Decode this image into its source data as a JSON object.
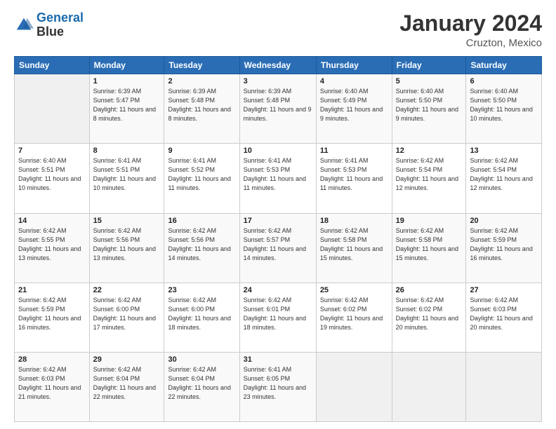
{
  "logo": {
    "line1": "General",
    "line2": "Blue"
  },
  "title": "January 2024",
  "location": "Cruzton, Mexico",
  "days_header": [
    "Sunday",
    "Monday",
    "Tuesday",
    "Wednesday",
    "Thursday",
    "Friday",
    "Saturday"
  ],
  "weeks": [
    [
      {
        "num": "",
        "sunrise": "",
        "sunset": "",
        "daylight": ""
      },
      {
        "num": "1",
        "sunrise": "Sunrise: 6:39 AM",
        "sunset": "Sunset: 5:47 PM",
        "daylight": "Daylight: 11 hours and 8 minutes."
      },
      {
        "num": "2",
        "sunrise": "Sunrise: 6:39 AM",
        "sunset": "Sunset: 5:48 PM",
        "daylight": "Daylight: 11 hours and 8 minutes."
      },
      {
        "num": "3",
        "sunrise": "Sunrise: 6:39 AM",
        "sunset": "Sunset: 5:48 PM",
        "daylight": "Daylight: 11 hours and 9 minutes."
      },
      {
        "num": "4",
        "sunrise": "Sunrise: 6:40 AM",
        "sunset": "Sunset: 5:49 PM",
        "daylight": "Daylight: 11 hours and 9 minutes."
      },
      {
        "num": "5",
        "sunrise": "Sunrise: 6:40 AM",
        "sunset": "Sunset: 5:50 PM",
        "daylight": "Daylight: 11 hours and 9 minutes."
      },
      {
        "num": "6",
        "sunrise": "Sunrise: 6:40 AM",
        "sunset": "Sunset: 5:50 PM",
        "daylight": "Daylight: 11 hours and 10 minutes."
      }
    ],
    [
      {
        "num": "7",
        "sunrise": "Sunrise: 6:40 AM",
        "sunset": "Sunset: 5:51 PM",
        "daylight": "Daylight: 11 hours and 10 minutes."
      },
      {
        "num": "8",
        "sunrise": "Sunrise: 6:41 AM",
        "sunset": "Sunset: 5:51 PM",
        "daylight": "Daylight: 11 hours and 10 minutes."
      },
      {
        "num": "9",
        "sunrise": "Sunrise: 6:41 AM",
        "sunset": "Sunset: 5:52 PM",
        "daylight": "Daylight: 11 hours and 11 minutes."
      },
      {
        "num": "10",
        "sunrise": "Sunrise: 6:41 AM",
        "sunset": "Sunset: 5:53 PM",
        "daylight": "Daylight: 11 hours and 11 minutes."
      },
      {
        "num": "11",
        "sunrise": "Sunrise: 6:41 AM",
        "sunset": "Sunset: 5:53 PM",
        "daylight": "Daylight: 11 hours and 11 minutes."
      },
      {
        "num": "12",
        "sunrise": "Sunrise: 6:42 AM",
        "sunset": "Sunset: 5:54 PM",
        "daylight": "Daylight: 11 hours and 12 minutes."
      },
      {
        "num": "13",
        "sunrise": "Sunrise: 6:42 AM",
        "sunset": "Sunset: 5:54 PM",
        "daylight": "Daylight: 11 hours and 12 minutes."
      }
    ],
    [
      {
        "num": "14",
        "sunrise": "Sunrise: 6:42 AM",
        "sunset": "Sunset: 5:55 PM",
        "daylight": "Daylight: 11 hours and 13 minutes."
      },
      {
        "num": "15",
        "sunrise": "Sunrise: 6:42 AM",
        "sunset": "Sunset: 5:56 PM",
        "daylight": "Daylight: 11 hours and 13 minutes."
      },
      {
        "num": "16",
        "sunrise": "Sunrise: 6:42 AM",
        "sunset": "Sunset: 5:56 PM",
        "daylight": "Daylight: 11 hours and 14 minutes."
      },
      {
        "num": "17",
        "sunrise": "Sunrise: 6:42 AM",
        "sunset": "Sunset: 5:57 PM",
        "daylight": "Daylight: 11 hours and 14 minutes."
      },
      {
        "num": "18",
        "sunrise": "Sunrise: 6:42 AM",
        "sunset": "Sunset: 5:58 PM",
        "daylight": "Daylight: 11 hours and 15 minutes."
      },
      {
        "num": "19",
        "sunrise": "Sunrise: 6:42 AM",
        "sunset": "Sunset: 5:58 PM",
        "daylight": "Daylight: 11 hours and 15 minutes."
      },
      {
        "num": "20",
        "sunrise": "Sunrise: 6:42 AM",
        "sunset": "Sunset: 5:59 PM",
        "daylight": "Daylight: 11 hours and 16 minutes."
      }
    ],
    [
      {
        "num": "21",
        "sunrise": "Sunrise: 6:42 AM",
        "sunset": "Sunset: 5:59 PM",
        "daylight": "Daylight: 11 hours and 16 minutes."
      },
      {
        "num": "22",
        "sunrise": "Sunrise: 6:42 AM",
        "sunset": "Sunset: 6:00 PM",
        "daylight": "Daylight: 11 hours and 17 minutes."
      },
      {
        "num": "23",
        "sunrise": "Sunrise: 6:42 AM",
        "sunset": "Sunset: 6:00 PM",
        "daylight": "Daylight: 11 hours and 18 minutes."
      },
      {
        "num": "24",
        "sunrise": "Sunrise: 6:42 AM",
        "sunset": "Sunset: 6:01 PM",
        "daylight": "Daylight: 11 hours and 18 minutes."
      },
      {
        "num": "25",
        "sunrise": "Sunrise: 6:42 AM",
        "sunset": "Sunset: 6:02 PM",
        "daylight": "Daylight: 11 hours and 19 minutes."
      },
      {
        "num": "26",
        "sunrise": "Sunrise: 6:42 AM",
        "sunset": "Sunset: 6:02 PM",
        "daylight": "Daylight: 11 hours and 20 minutes."
      },
      {
        "num": "27",
        "sunrise": "Sunrise: 6:42 AM",
        "sunset": "Sunset: 6:03 PM",
        "daylight": "Daylight: 11 hours and 20 minutes."
      }
    ],
    [
      {
        "num": "28",
        "sunrise": "Sunrise: 6:42 AM",
        "sunset": "Sunset: 6:03 PM",
        "daylight": "Daylight: 11 hours and 21 minutes."
      },
      {
        "num": "29",
        "sunrise": "Sunrise: 6:42 AM",
        "sunset": "Sunset: 6:04 PM",
        "daylight": "Daylight: 11 hours and 22 minutes."
      },
      {
        "num": "30",
        "sunrise": "Sunrise: 6:42 AM",
        "sunset": "Sunset: 6:04 PM",
        "daylight": "Daylight: 11 hours and 22 minutes."
      },
      {
        "num": "31",
        "sunrise": "Sunrise: 6:41 AM",
        "sunset": "Sunset: 6:05 PM",
        "daylight": "Daylight: 11 hours and 23 minutes."
      },
      {
        "num": "",
        "sunrise": "",
        "sunset": "",
        "daylight": ""
      },
      {
        "num": "",
        "sunrise": "",
        "sunset": "",
        "daylight": ""
      },
      {
        "num": "",
        "sunrise": "",
        "sunset": "",
        "daylight": ""
      }
    ]
  ]
}
